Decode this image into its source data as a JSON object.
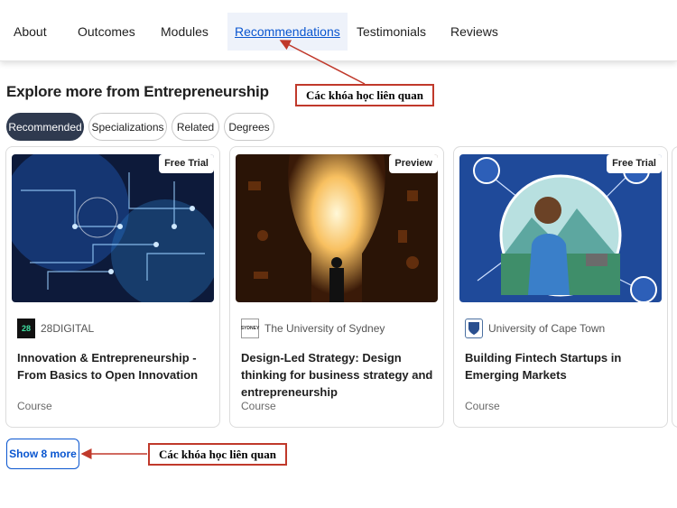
{
  "nav": {
    "tabs": [
      {
        "label": "About"
      },
      {
        "label": "Outcomes"
      },
      {
        "label": "Modules"
      },
      {
        "label": "Recommendations"
      },
      {
        "label": "Testimonials"
      },
      {
        "label": "Reviews"
      }
    ],
    "active_tab": "Recommendations"
  },
  "annotations": {
    "top": "Các khóa  học liên quan",
    "bottom": "Các khóa  học liên quan",
    "color": "#c0392b"
  },
  "section": {
    "title": "Explore more from Entrepreneurship",
    "chips": [
      {
        "label": "Recommended",
        "active": true
      },
      {
        "label": "Specializations",
        "active": false
      },
      {
        "label": "Related",
        "active": false
      },
      {
        "label": "Degrees",
        "active": false
      }
    ]
  },
  "cards": [
    {
      "badge": "Free Trial",
      "partner": "28DIGITAL",
      "partner_logo_text": "28",
      "title": "Innovation & Entrepreneurship - From Basics to Open Innovation",
      "type": "Course"
    },
    {
      "badge": "Preview",
      "partner": "The University of Sydney",
      "partner_logo_text": "SYDNEY",
      "title": "Design-Led Strategy: Design thinking for business strategy and entrepreneurship",
      "type": "Course"
    },
    {
      "badge": "Free Trial",
      "partner": "University of Cape Town",
      "partner_logo_text": "",
      "title": "Building Fintech Startups in Emerging Markets",
      "type": "Course"
    }
  ],
  "show_more": {
    "label": "Show 8 more"
  },
  "colors": {
    "accent": "#0a56d0",
    "chip_active": "#2f3a4f"
  }
}
